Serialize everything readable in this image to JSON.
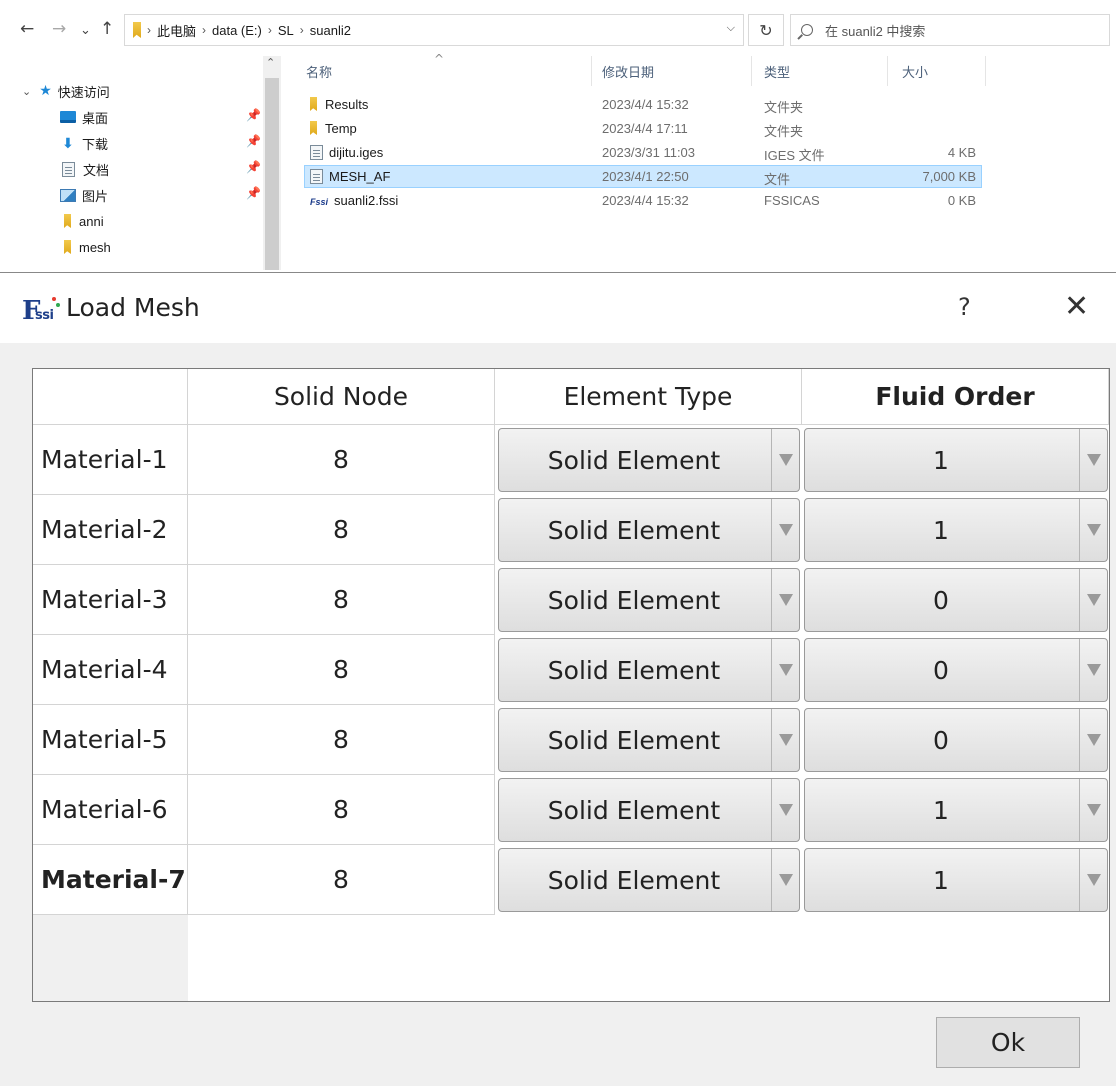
{
  "explorer": {
    "nav": {
      "back": "←",
      "forward": "→",
      "recent": "⌄",
      "up": "↑"
    },
    "breadcrumb": [
      "此电脑",
      "data (E:)",
      "SL",
      "suanli2"
    ],
    "search_placeholder": "在 suanli2 中搜索",
    "sidebar": {
      "quick_access": "快速访问",
      "items": [
        {
          "label": "桌面",
          "icon": "desktop-icon",
          "pinned": true
        },
        {
          "label": "下载",
          "icon": "download-icon",
          "pinned": true
        },
        {
          "label": "文档",
          "icon": "document-icon",
          "pinned": true
        },
        {
          "label": "图片",
          "icon": "pictures-icon",
          "pinned": true
        },
        {
          "label": "anni",
          "icon": "folder-icon",
          "pinned": false
        },
        {
          "label": "mesh",
          "icon": "folder-icon",
          "pinned": false
        }
      ]
    },
    "columns": {
      "name": "名称",
      "date": "修改日期",
      "type": "类型",
      "size": "大小"
    },
    "files": [
      {
        "name": "Results",
        "date": "2023/4/4 15:32",
        "type": "文件夹",
        "size": "",
        "icon": "folder-icon",
        "selected": false
      },
      {
        "name": "Temp",
        "date": "2023/4/4 17:11",
        "type": "文件夹",
        "size": "",
        "icon": "folder-icon",
        "selected": false
      },
      {
        "name": "dijitu.iges",
        "date": "2023/3/31 11:03",
        "type": "IGES 文件",
        "size": "4 KB",
        "icon": "file-icon",
        "selected": false
      },
      {
        "name": "MESH_AF",
        "date": "2023/4/1 22:50",
        "type": "文件",
        "size": "7,000 KB",
        "icon": "file-icon",
        "selected": true
      },
      {
        "name": "suanli2.fssi",
        "date": "2023/4/4 15:32",
        "type": "FSSICAS",
        "size": "0 KB",
        "icon": "fssi-file-icon",
        "selected": false
      }
    ]
  },
  "dialog": {
    "title": "Load Mesh",
    "help": "?",
    "close": "✕",
    "columns": [
      "Solid Node",
      "Element Type",
      "Fluid Order"
    ],
    "rows": [
      {
        "material": "Material-1",
        "solid_node": "8",
        "element_type": "Solid Element",
        "fluid_order": "1"
      },
      {
        "material": "Material-2",
        "solid_node": "8",
        "element_type": "Solid Element",
        "fluid_order": "1"
      },
      {
        "material": "Material-3",
        "solid_node": "8",
        "element_type": "Solid Element",
        "fluid_order": "0"
      },
      {
        "material": "Material-4",
        "solid_node": "8",
        "element_type": "Solid Element",
        "fluid_order": "0"
      },
      {
        "material": "Material-5",
        "solid_node": "8",
        "element_type": "Solid Element",
        "fluid_order": "0"
      },
      {
        "material": "Material-6",
        "solid_node": "8",
        "element_type": "Solid Element",
        "fluid_order": "1"
      },
      {
        "material": "Material-7",
        "solid_node": "8",
        "element_type": "Solid Element",
        "fluid_order": "1"
      }
    ],
    "ok_label": "Ok"
  },
  "colors": {
    "selection_bg": "#cce8ff",
    "dialog_bg": "#f0f0f0",
    "logo_blue": "#1e3f8a"
  }
}
